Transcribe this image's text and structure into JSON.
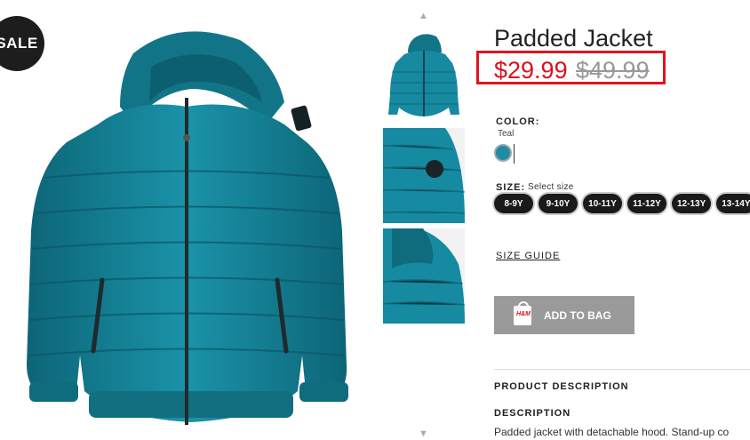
{
  "badge": {
    "sale": "SALE"
  },
  "product": {
    "title": "Padded Jacket",
    "price_now": "$29.99",
    "price_was": "$49.99"
  },
  "color": {
    "label": "COLOR:",
    "name": "Teal",
    "swatch": "#1f8ca3"
  },
  "size": {
    "label": "SIZE:",
    "hint": "Select size",
    "options": [
      "8-9Y",
      "9-10Y",
      "10-11Y",
      "11-12Y",
      "12-13Y",
      "13-14Y"
    ]
  },
  "links": {
    "size_guide": "SIZE GUIDE"
  },
  "actions": {
    "add_to_bag": "ADD TO BAG",
    "bag_logo": "H&M"
  },
  "description": {
    "section_title": "PRODUCT DESCRIPTION",
    "label": "DESCRIPTION",
    "text": "Padded jacket with detachable hood. Stand-up co"
  },
  "colors": {
    "accent": "#d9121e",
    "jacket": "#147f94",
    "button": "#9a9a9a"
  }
}
